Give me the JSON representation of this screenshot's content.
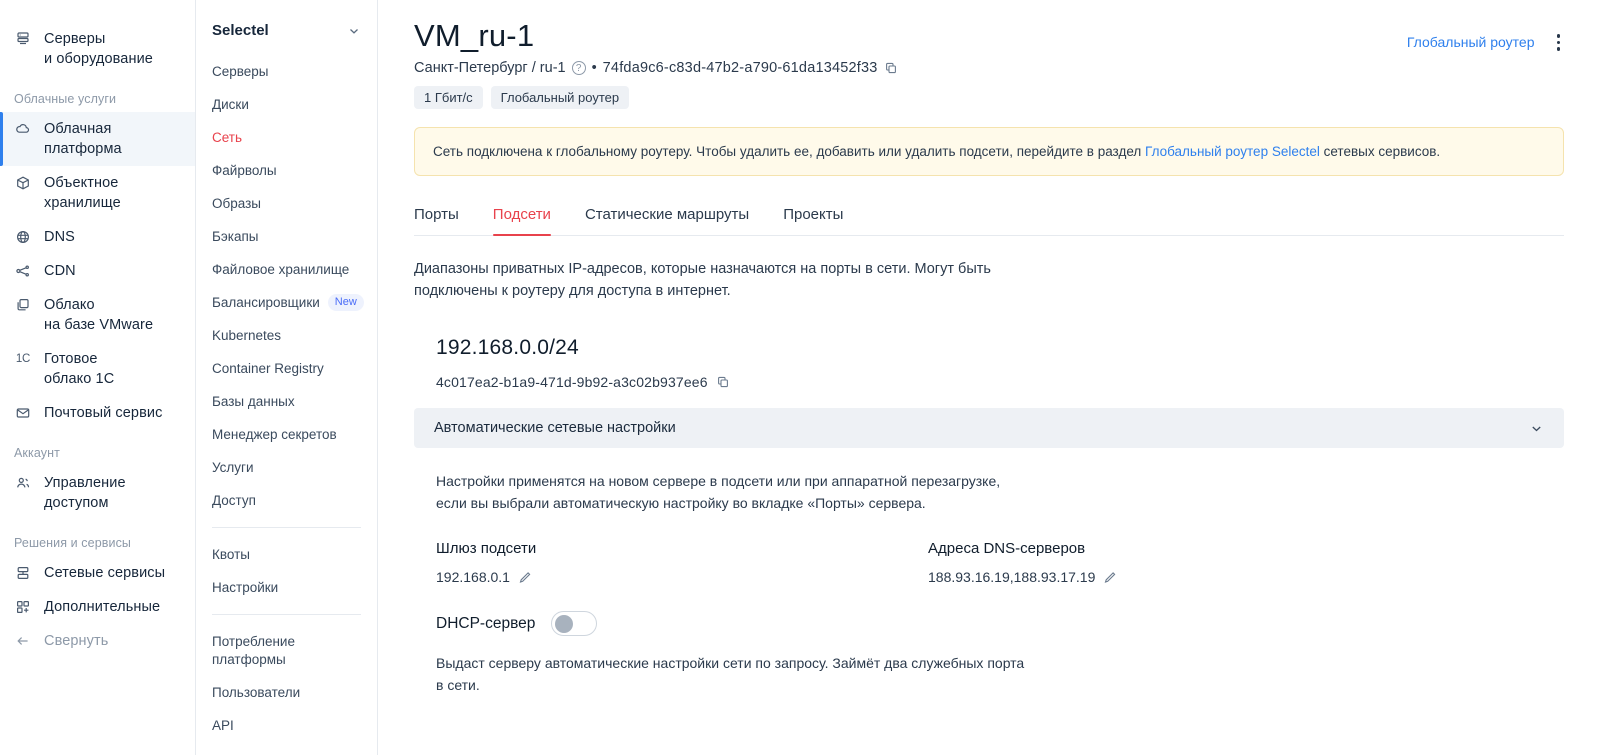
{
  "nav_primary": {
    "items": [
      {
        "label": "Серверы\nи оборудование",
        "icon": "servers-icon",
        "type": "item"
      },
      {
        "label": "Облачные услуги",
        "type": "group"
      },
      {
        "label": "Облачная\nплатформа",
        "icon": "cloud-icon",
        "type": "item",
        "active": true
      },
      {
        "label": "Объектное\nхранилище",
        "icon": "cube-icon",
        "type": "item"
      },
      {
        "label": "DNS",
        "icon": "globe-icon",
        "type": "item"
      },
      {
        "label": "CDN",
        "icon": "share-icon",
        "type": "item"
      },
      {
        "label": "Облако\nна базе VMware",
        "icon": "copy-stack-icon",
        "type": "item"
      },
      {
        "label": "Готовое\nоблако 1С",
        "icon": "one-c-icon",
        "type": "item"
      },
      {
        "label": "Почтовый сервис",
        "icon": "mail-icon",
        "type": "item"
      },
      {
        "label": "Аккаунт",
        "type": "group"
      },
      {
        "label": "Управление\nдоступом",
        "icon": "users-icon",
        "type": "item"
      },
      {
        "label": "Решения и сервисы",
        "type": "group"
      },
      {
        "label": "Сетевые сервисы",
        "icon": "network-icon",
        "type": "item"
      },
      {
        "label": "Дополнительные",
        "icon": "apps-icon",
        "type": "item"
      },
      {
        "label": "Свернуть",
        "icon": "arrow-left-icon",
        "type": "item",
        "muted": true
      }
    ]
  },
  "nav_product": {
    "brand": "Selectel",
    "items": [
      {
        "label": "Серверы"
      },
      {
        "label": "Диски"
      },
      {
        "label": "Сеть",
        "active": true
      },
      {
        "label": "Файрволы"
      },
      {
        "label": "Образы"
      },
      {
        "label": "Бэкапы"
      },
      {
        "label": "Файловое хранилище"
      },
      {
        "label": "Балансировщики",
        "badge": "New"
      },
      {
        "label": "Kubernetes"
      },
      {
        "label": "Container Registry"
      },
      {
        "label": "Базы данных"
      },
      {
        "label": "Менеджер секретов"
      },
      {
        "label": "Услуги"
      },
      {
        "label": "Доступ"
      },
      {
        "separator": true
      },
      {
        "label": "Квоты"
      },
      {
        "label": "Настройки"
      },
      {
        "separator": true
      },
      {
        "label": "Потребление\nплатформы"
      },
      {
        "label": "Пользователи"
      },
      {
        "label": "API"
      }
    ]
  },
  "header": {
    "title": "VM_ru-1",
    "region": "Санкт-Петербург / ru-1",
    "separator": "•",
    "uuid": "74fda9c6-c83d-47b2-a790-61da13452f33",
    "chips": [
      "1 Гбит/с",
      "Глобальный роутер"
    ],
    "action_link": "Глобальный роутер"
  },
  "alert": {
    "text_before": "Сеть подключена к глобальному роутеру. Чтобы удалить ее, добавить или удалить подсети, перейдите в раздел ",
    "link": "Глобальный роутер Selectel",
    "text_after": " сетевых сервисов."
  },
  "tabs": [
    {
      "label": "Порты"
    },
    {
      "label": "Подсети",
      "active": true
    },
    {
      "label": "Статические маршруты"
    },
    {
      "label": "Проекты"
    }
  ],
  "subnets": {
    "description": "Диапазоны приватных IP-адресов, которые назначаются на порты в сети. Могут быть\nподключены к роутеру для доступа в интернет.",
    "cidr": "192.168.0.0/24",
    "uuid": "4c017ea2-b1a9-471d-9b92-a3c02b937ee6",
    "collapse_title": "Автоматические сетевые настройки",
    "settings_note": "Настройки применятся на новом сервере в подсети или при аппаратной перезагрузке,\nесли вы выбрали автоматическую настройку во вкладке «Порты» сервера.",
    "gateway_label": "Шлюз подсети",
    "gateway_value": "192.168.0.1",
    "dns_label": "Адреса DNS-серверов",
    "dns_value": "188.93.16.19,188.93.17.19",
    "dhcp_label": "DHCP-сервер",
    "dhcp_enabled": false,
    "dhcp_note": "Выдаст серверу автоматические настройки сети по запросу. Займёт два служебных порта\nв сети."
  },
  "colors": {
    "accent_red": "#e8424c",
    "link_blue": "#2f80ed",
    "alert_bg": "#fffaea",
    "alert_border": "#f5e3ae",
    "chip_bg": "#eef1f5"
  }
}
